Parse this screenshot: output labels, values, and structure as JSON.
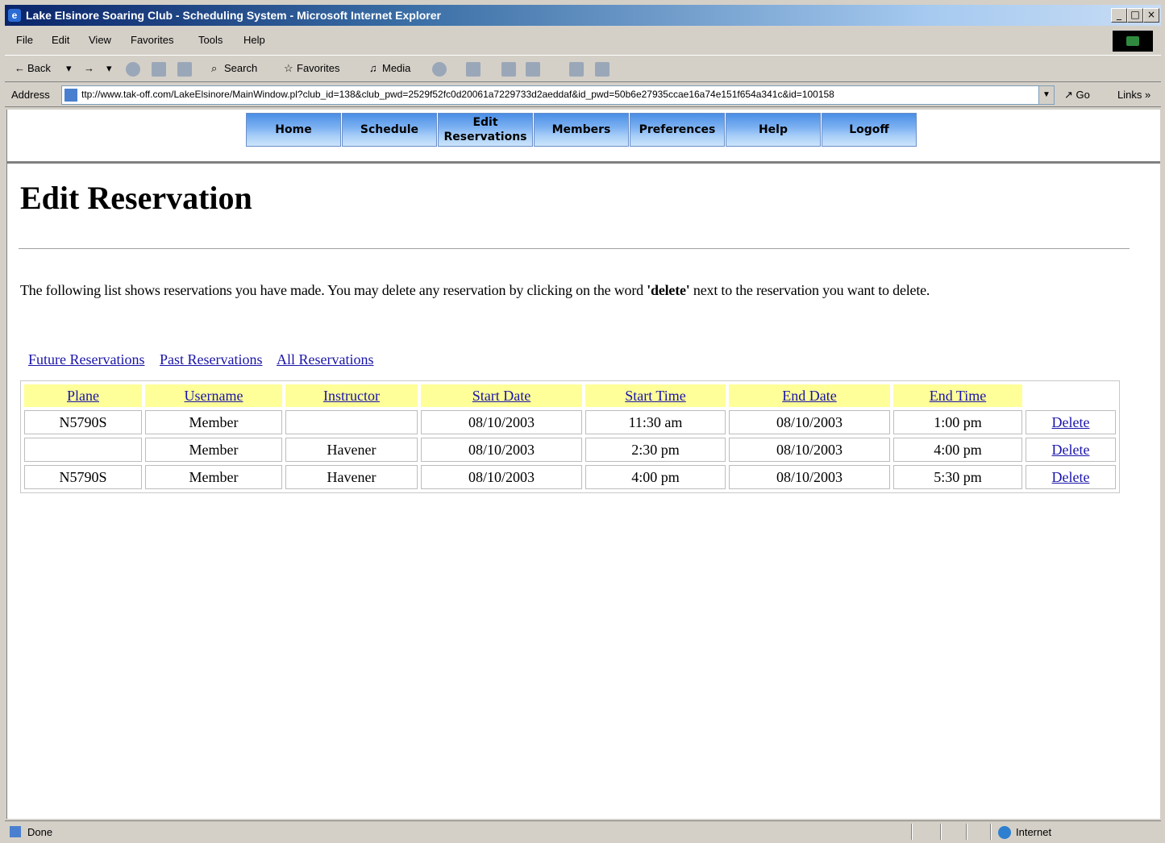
{
  "window": {
    "title": "Lake Elsinore Soaring Club - Scheduling System - Microsoft Internet Explorer",
    "min": "_",
    "max": "□",
    "close": "×"
  },
  "menu": [
    "File",
    "Edit",
    "View",
    "Favorites",
    "Tools",
    "Help"
  ],
  "toolbar": {
    "back": "Back",
    "search": "Search",
    "favorites": "Favorites",
    "media": "Media"
  },
  "address": {
    "label": "Address",
    "url": "ttp://www.tak-off.com/LakeElsinore/MainWindow.pl?club_id=138&club_pwd=2529f52fc0d20061a7229733d2aeddaf&id_pwd=50b6e27935ccae16a74e151f654a341c&id=100158",
    "go": "Go",
    "links": "Links"
  },
  "nav": [
    "Home",
    "Schedule",
    "Edit Reservations",
    "Members",
    "Preferences",
    "Help",
    "Logoff"
  ],
  "page": {
    "title": "Edit Reservation",
    "intro_before": "The following list shows reservations you have made.  You may delete any reservation by clicking on the word ",
    "intro_bold": "'delete'",
    "intro_after": " next to the reservation you want to delete."
  },
  "filters": [
    "Future Reservations",
    "Past Reservations",
    "All Reservations"
  ],
  "table": {
    "columns": [
      "Plane",
      "Username",
      "Instructor",
      "Start Date",
      "Start Time",
      "End Date",
      "End Time"
    ],
    "rows": [
      {
        "plane": "N5790S",
        "username": "Member",
        "instructor": "",
        "start_date": "08/10/2003",
        "start_time": "11:30 am",
        "end_date": "08/10/2003",
        "end_time": "1:00 pm",
        "action": "Delete"
      },
      {
        "plane": "",
        "username": "Member",
        "instructor": "Havener",
        "start_date": "08/10/2003",
        "start_time": "2:30 pm",
        "end_date": "08/10/2003",
        "end_time": "4:00 pm",
        "action": "Delete"
      },
      {
        "plane": "N5790S",
        "username": "Member",
        "instructor": "Havener",
        "start_date": "08/10/2003",
        "start_time": "4:00 pm",
        "end_date": "08/10/2003",
        "end_time": "5:30 pm",
        "action": "Delete"
      }
    ]
  },
  "status": {
    "left": "Done",
    "zone": "Internet"
  }
}
